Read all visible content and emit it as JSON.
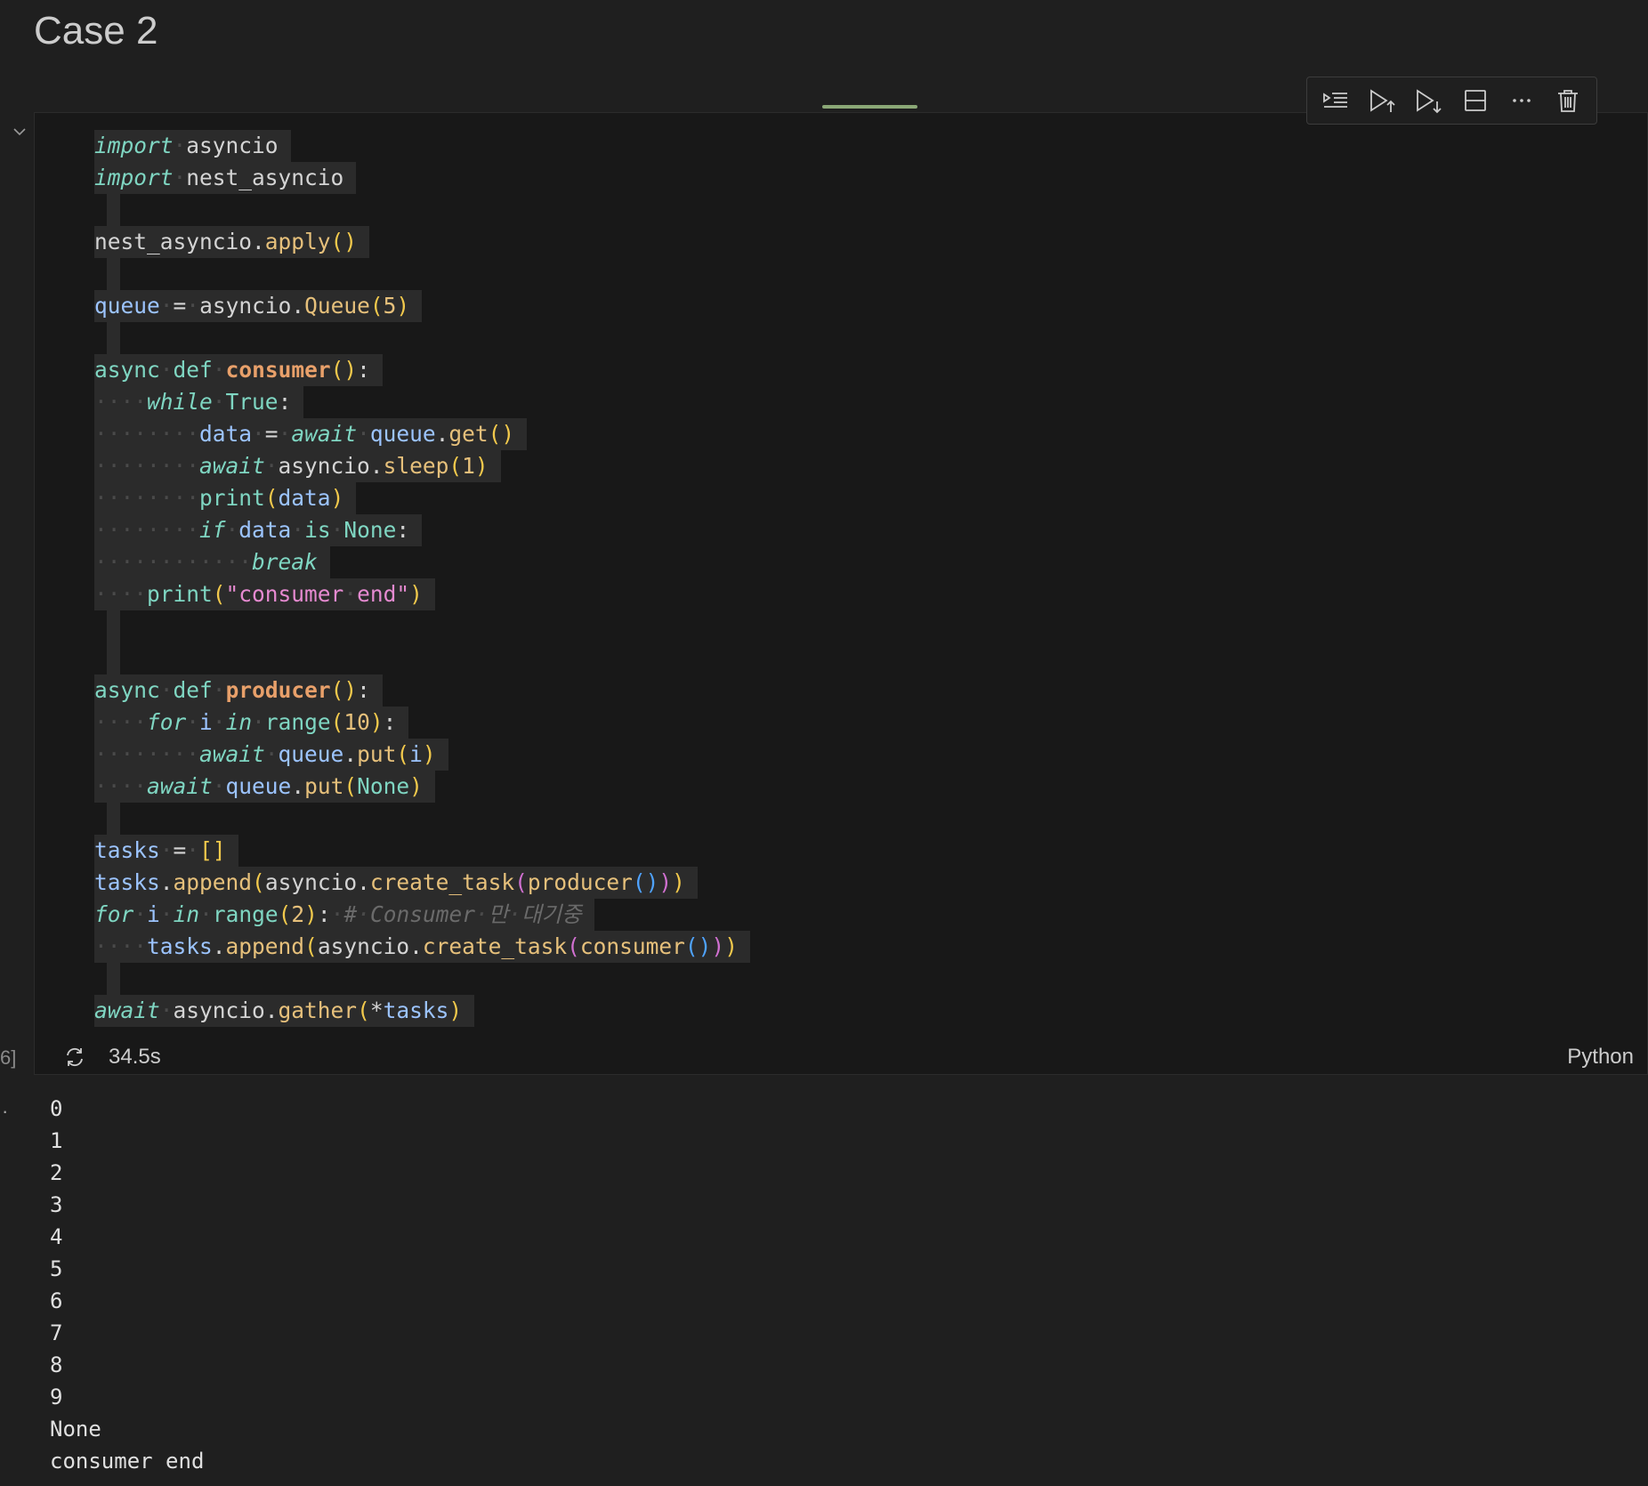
{
  "heading": "Case 2",
  "toolbar": {
    "buttons": [
      {
        "name": "run-by-line-button",
        "icon": "run-by-line-icon"
      },
      {
        "name": "execute-above-button",
        "icon": "execute-above-icon"
      },
      {
        "name": "execute-below-button",
        "icon": "execute-below-icon"
      },
      {
        "name": "split-cell-button",
        "icon": "split-cell-icon"
      },
      {
        "name": "more-actions-button",
        "icon": "more-icon"
      },
      {
        "name": "delete-cell-button",
        "icon": "trash-icon"
      }
    ]
  },
  "code_lines": [
    "import asyncio",
    "import nest_asyncio",
    "",
    "nest_asyncio.apply()",
    "",
    "queue = asyncio.Queue(5)",
    "",
    "async def consumer():",
    "    while True:",
    "        data = await queue.get()",
    "        await asyncio.sleep(1)",
    "        print(data)",
    "        if data is None:",
    "            break",
    "    print(\"consumer end\")",
    "",
    "",
    "async def producer():",
    "    for i in range(10):",
    "        await queue.put(i)",
    "    await queue.put(None)",
    "",
    "tasks = []",
    "tasks.append(asyncio.create_task(producer()))",
    "for i in range(2): # Consumer 만 대기중",
    "    tasks.append(asyncio.create_task(consumer()))",
    "",
    "await asyncio.gather(*tasks)"
  ],
  "status": {
    "execution_count": "6]",
    "duration": "34.5s",
    "language": "Python"
  },
  "output_lines": [
    "0",
    "1",
    "2",
    "3",
    "4",
    "5",
    "6",
    "7",
    "8",
    "9",
    "None",
    "consumer end"
  ],
  "colors": {
    "keyword": "#7fd6c2",
    "function": "#e6c07b",
    "definition": "#e8a06a",
    "variable": "#9cc4ff",
    "string": "#e58ad0",
    "comment": "#6a6a6a"
  }
}
